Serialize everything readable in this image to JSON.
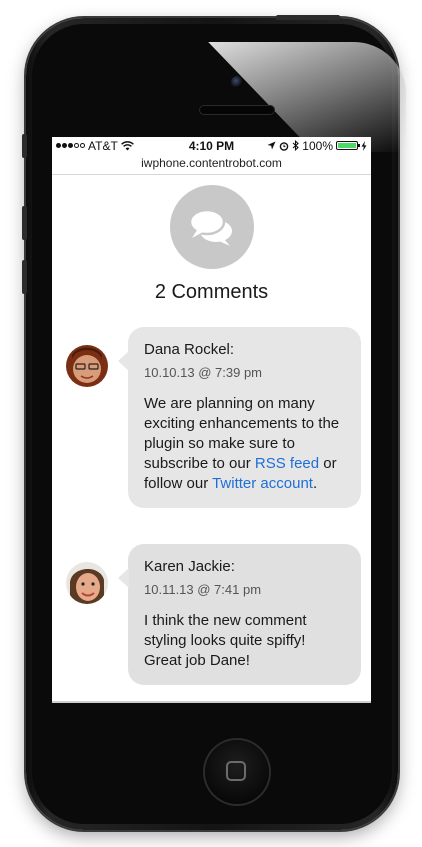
{
  "status": {
    "carrier": "AT&T",
    "time": "4:10 PM",
    "battery": "100%",
    "signal_bars_filled": 3,
    "signal_bars_total": 5,
    "battery_level": 1.0
  },
  "browser": {
    "url": "iwphone.contentrobot.com"
  },
  "header": {
    "icon": "speech-bubbles-icon",
    "title": "2 Comments"
  },
  "comments": [
    {
      "author": "Dana Rockel:",
      "date": "10.10.13 @ 7:39 pm",
      "text_before": "We are planning on many exciting enhancements to the plugin so make sure to subscribe to our ",
      "link1": "RSS feed",
      "text_middle": " or follow our ",
      "link2": "Twitter account",
      "text_after": "."
    },
    {
      "author": "Karen Jackie:",
      "date": "10.11.13 @ 7:41 pm",
      "text": "I think the new comment styling looks quite spiffy! Great job Dane!"
    }
  ],
  "colors": {
    "link": "#1e6fd6",
    "card_background": "#e6e6e6",
    "icon_circle": "#c8c8c8",
    "battery_fill": "#4cd964"
  }
}
